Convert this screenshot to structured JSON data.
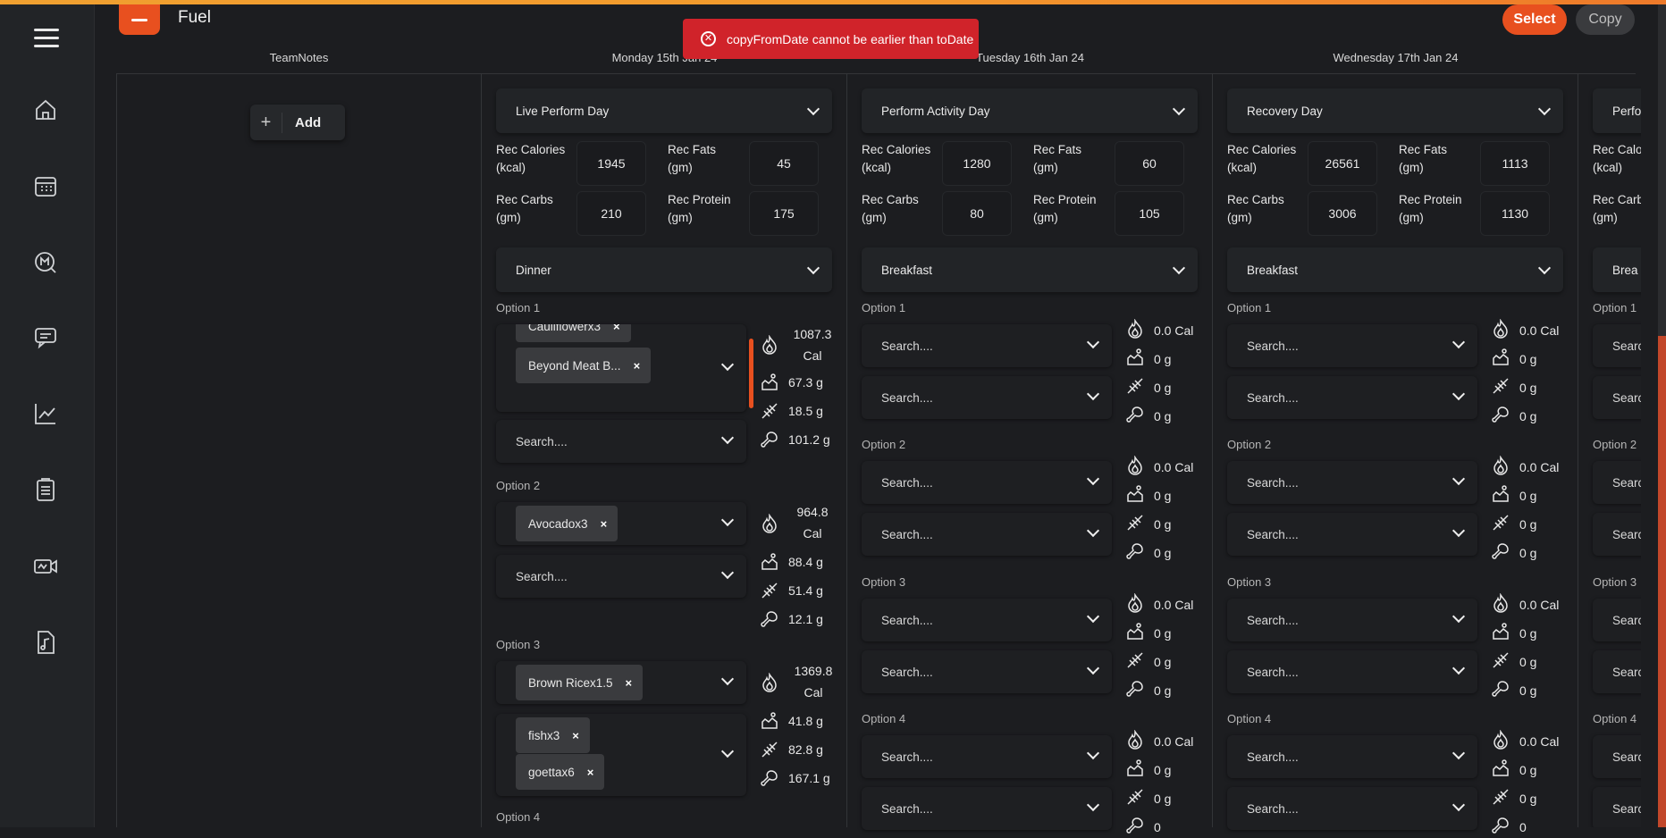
{
  "app": {
    "title": "Fuel",
    "select_label": "Select",
    "copy_label": "Copy",
    "accent": "#e8501f"
  },
  "toast": {
    "message": "copyFromDate cannot be earlier than toDate",
    "color": "#d0232a"
  },
  "sidebar": {
    "items": [
      "home-icon",
      "calendar-icon",
      "search-m-icon",
      "chat-icon",
      "chart-icon",
      "clipboard-icon",
      "video-icon",
      "music-file-icon"
    ]
  },
  "columns": {
    "notes": {
      "header": "TeamNotes",
      "add_label": "Add"
    },
    "days": [
      {
        "header": "Monday 15th Jan 24",
        "day_type": "Live Perform Day",
        "rec_calories_label": "Rec Calories (kcal)",
        "rec_calories": "1945",
        "rec_fats_label": "Rec Fats (gm)",
        "rec_fats": "45",
        "rec_carbs_label": "Rec Carbs (gm)",
        "rec_carbs": "210",
        "rec_protein_label": "Rec Protein (gm)",
        "rec_protein": "175",
        "meal": "Dinner",
        "options": [
          {
            "label": "Option 1",
            "chips": [
              "Cauliflowerx3",
              "Beyond Meat B..."
            ],
            "search": "Search....",
            "cal": "1087.3",
            "cal_unit": "Cal",
            "fat": "67.3 g",
            "carbs": "18.5 g",
            "protein": "101.2 g"
          },
          {
            "label": "Option 2",
            "chips": [
              "Avocadox3"
            ],
            "search": "Search....",
            "cal": "964.8",
            "cal_unit": "Cal",
            "fat": "88.4 g",
            "carbs": "51.4 g",
            "protein": "12.1 g"
          },
          {
            "label": "Option 3",
            "chips": [
              "Brown Ricex1.5",
              "fishx3",
              "goettax6"
            ],
            "cal": "1369.8",
            "cal_unit": "Cal",
            "fat": "41.8 g",
            "carbs": "82.8 g",
            "protein": "167.1 g"
          },
          {
            "label": "Option 4"
          }
        ]
      },
      {
        "header": "Tuesday 16th Jan 24",
        "day_type": "Perform Activity Day",
        "rec_calories_label": "Rec Calories (kcal)",
        "rec_calories": "1280",
        "rec_fats_label": "Rec Fats (gm)",
        "rec_fats": "60",
        "rec_carbs_label": "Rec Carbs (gm)",
        "rec_carbs": "80",
        "rec_protein_label": "Rec Protein (gm)",
        "rec_protein": "105",
        "meal": "Breakfast",
        "options": [
          {
            "label": "Option 1",
            "search": "Search....",
            "cal": "0.0 Cal",
            "fat": "0 g",
            "carbs": "0 g",
            "protein": "0 g"
          },
          {
            "label": "Option 2",
            "search": "Search....",
            "cal": "0.0 Cal",
            "fat": "0 g",
            "carbs": "0 g",
            "protein": "0 g"
          },
          {
            "label": "Option 3",
            "search": "Search....",
            "cal": "0.0 Cal",
            "fat": "0 g",
            "carbs": "0 g",
            "protein": "0 g"
          },
          {
            "label": "Option 4",
            "search": "Search....",
            "cal": "0.0 Cal",
            "fat": "0 g",
            "carbs": "0 g",
            "protein": "0"
          }
        ]
      },
      {
        "header": "Wednesday 17th Jan 24",
        "day_type": "Recovery Day",
        "rec_calories_label": "Rec Calories (kcal)",
        "rec_calories": "26561",
        "rec_fats_label": "Rec Fats (gm)",
        "rec_fats": "1113",
        "rec_carbs_label": "Rec Carbs (gm)",
        "rec_carbs": "3006",
        "rec_protein_label": "Rec Protein (gm)",
        "rec_protein": "1130",
        "meal": "Breakfast",
        "options": [
          {
            "label": "Option 1",
            "search": "Search....",
            "cal": "0.0 Cal",
            "fat": "0 g",
            "carbs": "0 g",
            "protein": "0 g"
          },
          {
            "label": "Option 2",
            "search": "Search....",
            "cal": "0.0 Cal",
            "fat": "0 g",
            "carbs": "0 g",
            "protein": "0 g"
          },
          {
            "label": "Option 3",
            "search": "Search....",
            "cal": "0.0 Cal",
            "fat": "0 g",
            "carbs": "0 g",
            "protein": "0 g"
          },
          {
            "label": "Option 4",
            "search": "Search....",
            "cal": "0.0 Cal",
            "fat": "0 g",
            "carbs": "0 g",
            "protein": "0"
          }
        ]
      },
      {
        "day_type": "Perfo",
        "rec_calories_label": "Rec Calo (kcal)",
        "rec_carbs_label": "Rec Carb (gm)",
        "meal": "Brea",
        "options": [
          {
            "label": "Option 1",
            "search": "Searc"
          },
          {
            "label": "Option 2",
            "search": "Searc"
          },
          {
            "label": "Option 3",
            "search": "Searc"
          },
          {
            "label": "Option 4",
            "search": "Searc"
          }
        ]
      }
    ]
  }
}
